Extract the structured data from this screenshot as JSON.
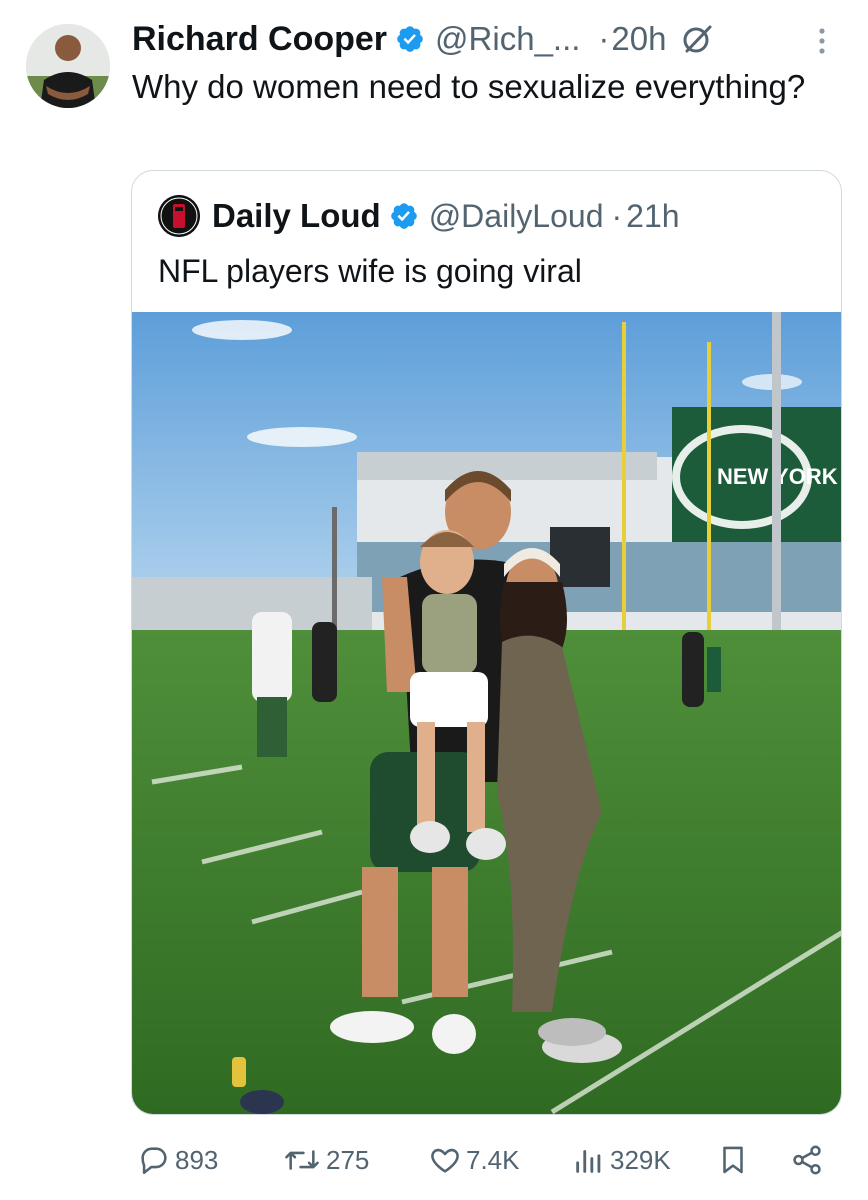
{
  "tweet": {
    "author_name": "Richard Cooper",
    "handle": "@Rich_...",
    "dot": "·",
    "time": "20h",
    "text": "Why do women need to sexualize everything?"
  },
  "quoted_tweet": {
    "author_name": "Daily Loud",
    "handle": "@DailyLoud",
    "dot": "·",
    "time": "21h",
    "text": "NFL players wife is going viral",
    "media_sign_text": "NEW YORK JETS"
  },
  "actions": {
    "replies": "893",
    "reposts": "275",
    "likes": "7.4K",
    "views": "329K"
  },
  "colors": {
    "verified_blue": "#1d9bf0",
    "secondary_text": "#536471",
    "border": "#cfd9de",
    "jets_green": "#1c5c3a"
  },
  "icons": [
    "verified-badge-icon",
    "grok-icon",
    "more-icon",
    "reply-icon",
    "repost-icon",
    "like-icon",
    "views-icon",
    "bookmark-icon",
    "share-icon"
  ]
}
